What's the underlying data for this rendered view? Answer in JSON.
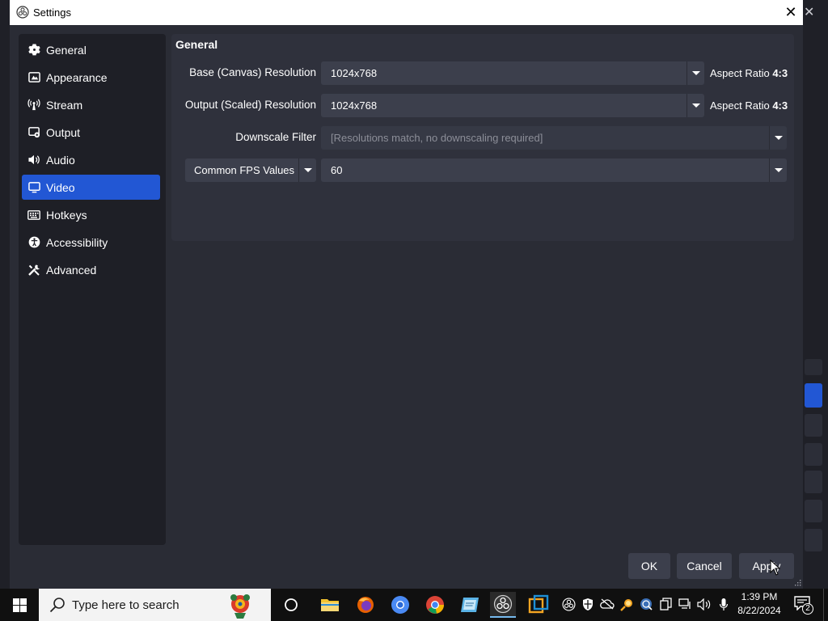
{
  "dialog": {
    "title": "Settings",
    "close_glyph": "✕"
  },
  "sidebar": {
    "items": [
      {
        "label": "General",
        "icon": "gear-icon"
      },
      {
        "label": "Appearance",
        "icon": "appearance-icon"
      },
      {
        "label": "Stream",
        "icon": "broadcast-icon"
      },
      {
        "label": "Output",
        "icon": "output-icon"
      },
      {
        "label": "Audio",
        "icon": "speaker-icon"
      },
      {
        "label": "Video",
        "icon": "monitor-icon",
        "active": true
      },
      {
        "label": "Hotkeys",
        "icon": "keyboard-icon"
      },
      {
        "label": "Accessibility",
        "icon": "accessibility-icon"
      },
      {
        "label": "Advanced",
        "icon": "tools-icon"
      }
    ]
  },
  "video": {
    "section_title": "General",
    "base_resolution": {
      "label": "Base (Canvas) Resolution",
      "value": "1024x768",
      "aspect_prefix": "Aspect Ratio",
      "aspect": "4:3"
    },
    "output_resolution": {
      "label": "Output (Scaled) Resolution",
      "value": "1024x768",
      "aspect_prefix": "Aspect Ratio",
      "aspect": "4:3"
    },
    "downscale_filter": {
      "label": "Downscale Filter",
      "value": "[Resolutions match, no downscaling required]",
      "disabled": true
    },
    "fps": {
      "type_value": "Common FPS Values",
      "value": "60"
    }
  },
  "buttons": {
    "ok": "OK",
    "cancel": "Cancel",
    "apply": "Apply"
  },
  "taskbar": {
    "search_placeholder": "Type here to search",
    "time": "1:39 PM",
    "date": "8/22/2024",
    "notification_count": "2"
  },
  "colors": {
    "accent": "#2257d4",
    "dialog_bg": "#2a2c35",
    "panel_bg": "#2f313c",
    "sidebar_bg": "#1e1f26",
    "input_bg": "#3c3f4c"
  }
}
